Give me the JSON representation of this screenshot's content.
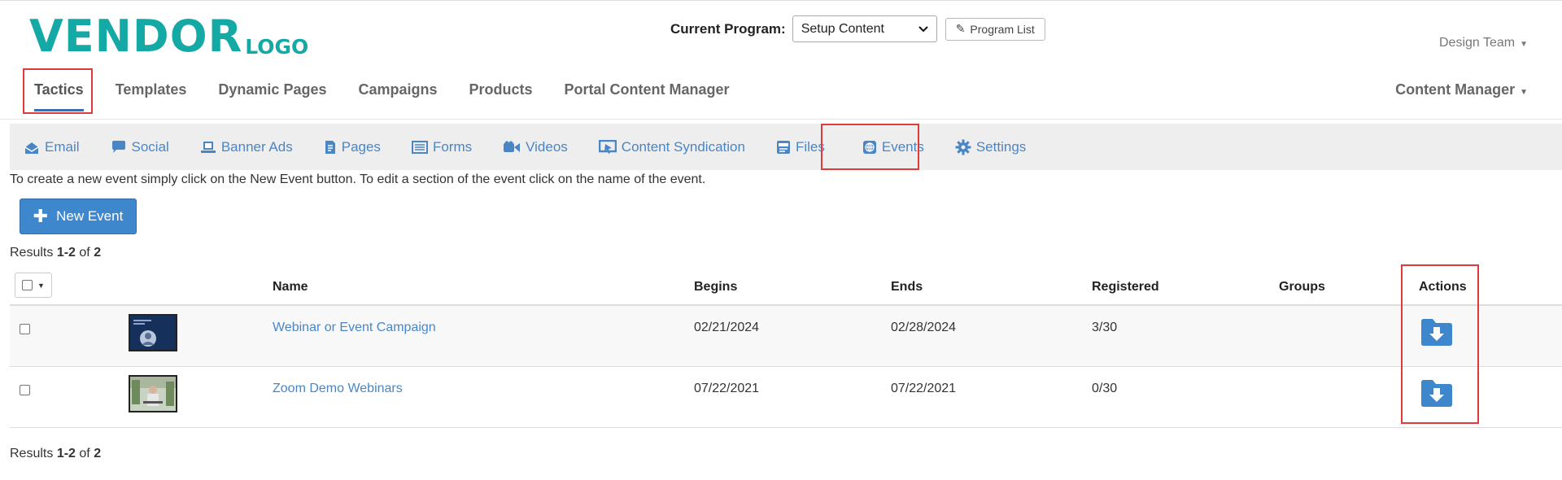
{
  "header": {
    "logo_main": "VENDOR",
    "logo_sub": "LOGO",
    "program_label": "Current Program:",
    "program_selected": "Setup Content",
    "program_list_label": "Program List",
    "team_label": "Design Team",
    "role_label": "Content Manager"
  },
  "main_nav": [
    {
      "label": "Tactics",
      "active": true
    },
    {
      "label": "Templates"
    },
    {
      "label": "Dynamic Pages"
    },
    {
      "label": "Campaigns"
    },
    {
      "label": "Products"
    },
    {
      "label": "Portal Content Manager"
    }
  ],
  "sub_nav": [
    {
      "label": "Email",
      "icon": "email-icon"
    },
    {
      "label": "Social",
      "icon": "chat-bubble-icon"
    },
    {
      "label": "Banner Ads",
      "icon": "laptop-icon"
    },
    {
      "label": "Pages",
      "icon": "document-icon"
    },
    {
      "label": "Forms",
      "icon": "list-icon"
    },
    {
      "label": "Videos",
      "icon": "video-camera-icon"
    },
    {
      "label": "Content Syndication",
      "icon": "monitor-pointer-icon"
    },
    {
      "label": "Files",
      "icon": "file-doc-icon"
    },
    {
      "label": "Events",
      "icon": "globe-icon",
      "active": true
    },
    {
      "label": "Settings",
      "icon": "gear-icon"
    }
  ],
  "instruction": "To create a new event simply click on the New Event button. To edit a section of the event click on the name of the event.",
  "new_event_label": "New Event",
  "results": {
    "prefix": "Results",
    "range": "1-2",
    "of": "of",
    "total": "2"
  },
  "table": {
    "headers": {
      "name": "Name",
      "begins": "Begins",
      "ends": "Ends",
      "registered": "Registered",
      "groups": "Groups",
      "actions": "Actions"
    },
    "rows": [
      {
        "name": "Webinar or Event Campaign",
        "begins": "02/21/2024",
        "ends": "02/28/2024",
        "registered": "3/30",
        "groups": ""
      },
      {
        "name": "Zoom Demo Webinars",
        "begins": "07/22/2021",
        "ends": "07/22/2021",
        "registered": "0/30",
        "groups": ""
      }
    ]
  },
  "colors": {
    "logo": "#15a9a5",
    "link": "#4a86c5",
    "primary_button": "#3f87cc",
    "highlight": "#e03a3a"
  }
}
